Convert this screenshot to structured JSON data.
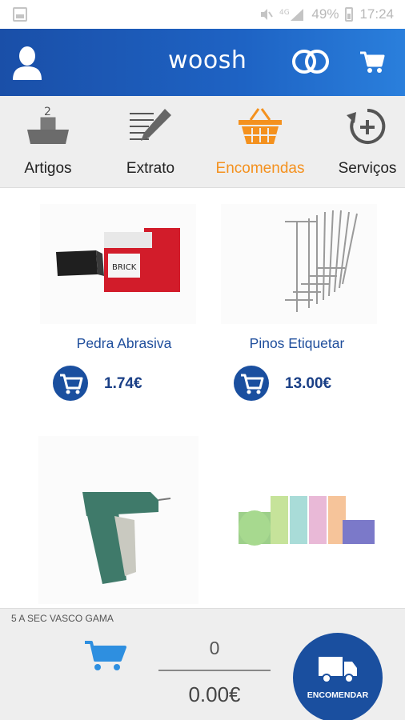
{
  "status_bar": {
    "network": "4G",
    "battery": "49%",
    "time": "17:24"
  },
  "app_bar": {
    "logo": "woosh"
  },
  "tabs": [
    {
      "label": "Artigos",
      "icon": "shelf-icon",
      "active": false
    },
    {
      "label": "Extrato",
      "icon": "document-pencil-icon",
      "active": false
    },
    {
      "label": "Encomendas",
      "icon": "basket-icon",
      "active": true
    },
    {
      "label": "Serviços",
      "icon": "refresh-plus-icon",
      "active": false
    }
  ],
  "products": [
    {
      "name": "Pedra Abrasiva",
      "price": "1.74€"
    },
    {
      "name": "Pinos Etiquetar",
      "price": "13.00€"
    },
    {
      "name": "",
      "price": ""
    },
    {
      "name": "",
      "price": ""
    }
  ],
  "bottom": {
    "store_name": "5 A SEC VASCO GAMA",
    "quantity": "0",
    "total": "0.00€",
    "order_label": "ENCOMENDAR"
  },
  "colors": {
    "brand_blue": "#1a4f9f",
    "active_tab": "#f4911e",
    "bottom_cart": "#2e8fe0"
  }
}
